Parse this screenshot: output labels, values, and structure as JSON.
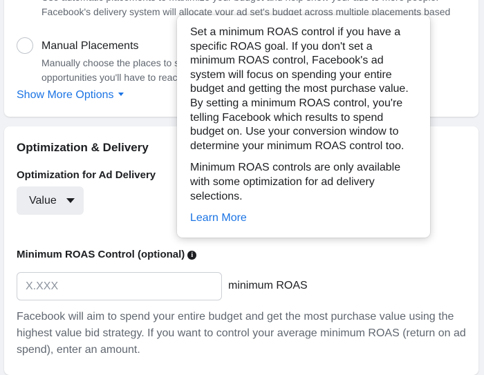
{
  "placements": {
    "auto_description_partial": "Use automatic placements to maximize your budget and help show your ads to more people. Facebook's delivery system will allocate your ad set's budget across multiple placements based on where they're likely to perform best.",
    "manual_label": "Manual Placements",
    "manual_description_partial": "Manually choose the places to show your ad. The fewer placements you select, the fewer opportunities you'll have to reach your target audience.",
    "show_more": "Show More Options"
  },
  "optimization": {
    "heading": "Optimization & Delivery",
    "delivery_label": "Optimization for Ad Delivery",
    "delivery_value": "Value",
    "roas_label": "Minimum ROAS Control (optional)",
    "info_icon": "i",
    "roas_placeholder": "X.XXX",
    "roas_suffix": "minimum ROAS",
    "roas_help": "Facebook will aim to spend your entire budget and get the most purchase value using the highest value bid strategy. If you want to control your average minimum ROAS (return on ad spend), enter an amount."
  },
  "tooltip": {
    "paragraph1": "Set a minimum ROAS control if you have a specific ROAS goal. If you don't set a minimum ROAS control, Facebook's ad system will focus on spending your entire budget and getting the most purchase value. By setting a minimum ROAS control, you're telling Facebook which results to spend budget on. Use your conversion window to determine your minimum ROAS control too.",
    "paragraph2": "Minimum ROAS controls are only available with some optimization for ad delivery selections.",
    "learn_more": "Learn More"
  },
  "icons": {
    "caret": "caret-down-icon",
    "info": "info-circle-icon"
  },
  "colors": {
    "link": "#1b74e4",
    "background": "#f0f2f5"
  }
}
